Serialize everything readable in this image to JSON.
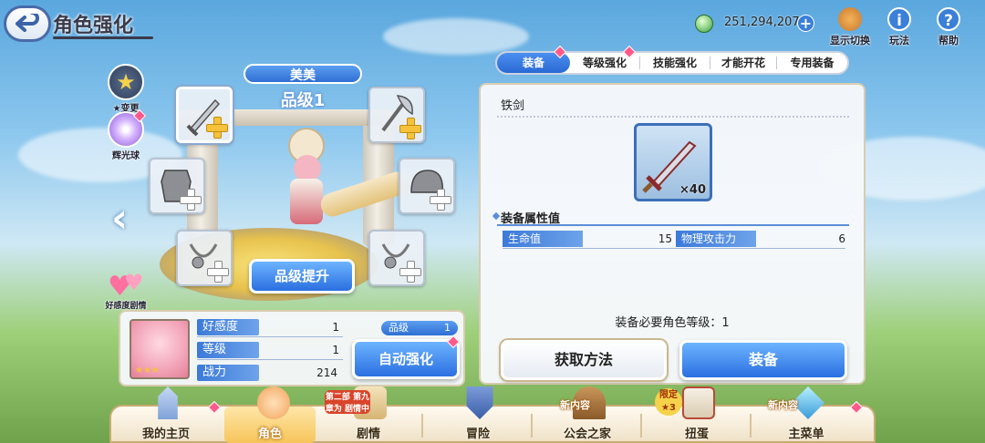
{
  "header": {
    "title": "角色强化",
    "currency": "251,294,207",
    "top_icons": [
      {
        "label": "显示切换",
        "icon": "display-switch-icon"
      },
      {
        "label": "玩法",
        "icon": "info-icon"
      },
      {
        "label": "帮助",
        "icon": "help-icon"
      }
    ]
  },
  "left_icons": [
    {
      "label": "★变更",
      "icon": "star-change-icon"
    },
    {
      "label": "辉光球",
      "icon": "glow-orb-icon"
    },
    {
      "label": "好感度剧情",
      "icon": "heart-icon"
    }
  ],
  "character": {
    "name": "美美",
    "rank": "品级1",
    "rank_up_label": "品级提升"
  },
  "stats": {
    "rows": [
      {
        "label": "好感度",
        "value": "1"
      },
      {
        "label": "等级",
        "value": "1"
      },
      {
        "label": "战力",
        "value": "214"
      }
    ],
    "rank_label": "品级",
    "rank_value": "1",
    "auto_enhance_label": "自动强化"
  },
  "tabs": [
    {
      "label": "装备",
      "active": true
    },
    {
      "label": "等级强化",
      "active": false
    },
    {
      "label": "技能强化",
      "active": false
    },
    {
      "label": "才能开花",
      "active": false
    },
    {
      "label": "专用装备",
      "active": false
    }
  ],
  "item": {
    "name": "铁剑",
    "count": "×40",
    "props_title": "装备属性值",
    "props": [
      {
        "label": "生命值",
        "value": "15"
      },
      {
        "label": "物理攻击力",
        "value": "6"
      }
    ],
    "requirement": "装备必要角色等级：1",
    "obtain_label": "获取方法",
    "equip_label": "装备"
  },
  "bottom_nav": [
    {
      "label": "我的主页",
      "active": false,
      "tag": ""
    },
    {
      "label": "角色",
      "active": true,
      "tag": ""
    },
    {
      "label": "剧情",
      "active": false,
      "tag": "第二部 第九章为 剧情中"
    },
    {
      "label": "冒险",
      "active": false,
      "tag": ""
    },
    {
      "label": "公会之家",
      "active": false,
      "tag": "新内容"
    },
    {
      "label": "扭蛋",
      "active": false,
      "tag": "限定 ★3"
    },
    {
      "label": "主菜单",
      "active": false,
      "tag": "新内容"
    }
  ],
  "colors": {
    "accent_blue": "#2a6fe0",
    "badge_pink": "#ff5a8a",
    "gold": "#f5c23a"
  }
}
